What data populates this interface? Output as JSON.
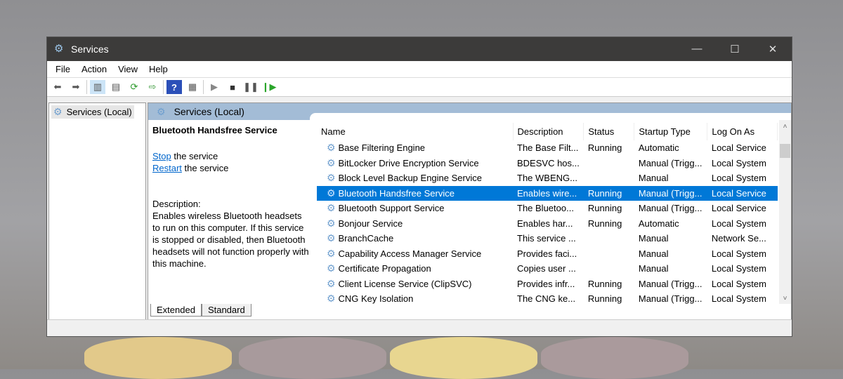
{
  "window": {
    "title": "Services",
    "min": "—",
    "max": "☐",
    "close": "✕"
  },
  "menu": [
    "File",
    "Action",
    "View",
    "Help"
  ],
  "tree": {
    "item": "Services (Local)"
  },
  "header": {
    "title": "Services (Local)"
  },
  "extended": {
    "service_name": "Bluetooth Handsfree Service",
    "stop_link": "Stop",
    "stop_rest": " the service",
    "restart_link": "Restart",
    "restart_rest": " the service",
    "desc_label": "Description:",
    "description": "Enables wireless Bluetooth headsets to run on this computer. If this service is stopped or disabled, then Bluetooth headsets will not function properly with this machine."
  },
  "columns": [
    "Name",
    "Description",
    "Status",
    "Startup Type",
    "Log On As"
  ],
  "rows": [
    [
      "Base Filtering Engine",
      "The Base Filt...",
      "Running",
      "Automatic",
      "Local Service"
    ],
    [
      "BitLocker Drive Encryption Service",
      "BDESVC hos...",
      "",
      "Manual (Trigg...",
      "Local System"
    ],
    [
      "Block Level Backup Engine Service",
      "The WBENG...",
      "",
      "Manual",
      "Local System"
    ],
    [
      "Bluetooth Handsfree Service",
      "Enables wire...",
      "Running",
      "Manual (Trigg...",
      "Local Service"
    ],
    [
      "Bluetooth Support Service",
      "The Bluetoo...",
      "Running",
      "Manual (Trigg...",
      "Local Service"
    ],
    [
      "Bonjour Service",
      "Enables har...",
      "Running",
      "Automatic",
      "Local System"
    ],
    [
      "BranchCache",
      "This service ...",
      "",
      "Manual",
      "Network Se..."
    ],
    [
      "Capability Access Manager Service",
      "Provides faci...",
      "",
      "Manual",
      "Local System"
    ],
    [
      "Certificate Propagation",
      "Copies user ...",
      "",
      "Manual",
      "Local System"
    ],
    [
      "Client License Service (ClipSVC)",
      "Provides infr...",
      "Running",
      "Manual (Trigg...",
      "Local System"
    ],
    [
      "CNG Key Isolation",
      "The CNG ke...",
      "Running",
      "Manual (Trigg...",
      "Local System"
    ]
  ],
  "selected_row": 3,
  "tabs": [
    "Extended",
    "Standard"
  ]
}
